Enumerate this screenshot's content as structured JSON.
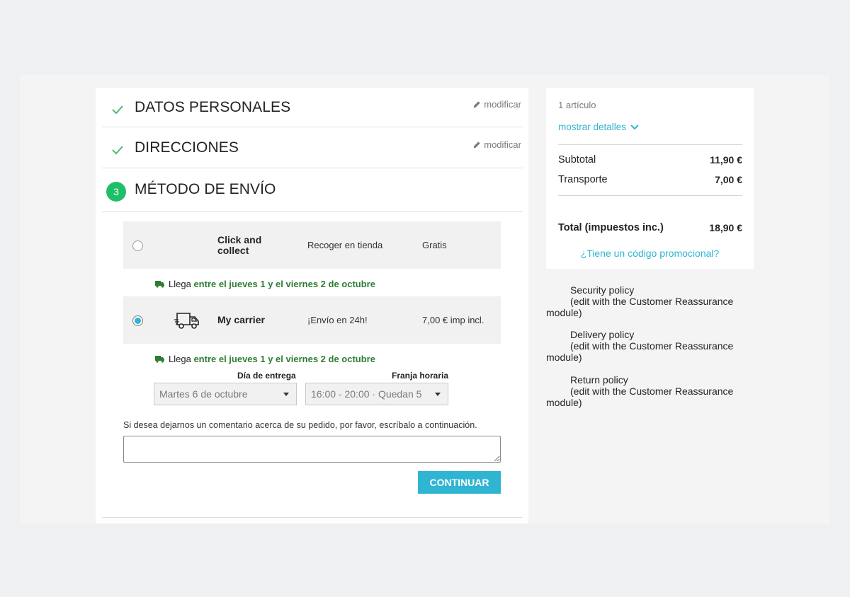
{
  "steps": [
    {
      "title": "DATOS PERSONALES",
      "edit_label": "modificar"
    },
    {
      "title": "DIRECCIONES",
      "edit_label": "modificar"
    },
    {
      "number": "3",
      "title": "MÉTODO DE ENVÍO"
    }
  ],
  "carriers": [
    {
      "name": "Click and collect",
      "delay": "Recoger en tienda",
      "price": "Gratis",
      "selected": false
    },
    {
      "name": "My carrier",
      "delay": "¡Envío en 24h!",
      "price": "7,00 € imp incl.",
      "selected": true,
      "icon": "truck-icon"
    }
  ],
  "eta": {
    "prefix": "Llega",
    "range": "entre el jueves 1 y el viernes 2 de octubre"
  },
  "delivery": {
    "day_label": "Día de entrega",
    "day_value": "Martes 6 de octubre",
    "slot_label": "Franja horaria",
    "slot_value": "16:00 - 20:00 · Quedan 5"
  },
  "comment": {
    "label": "Si desea dejarnos un comentario acerca de su pedido, por favor, escríbalo a continuación.",
    "value": ""
  },
  "continue_label": "CONTINUAR",
  "summary": {
    "item_count": "1 artículo",
    "show_details": "mostrar detalles",
    "subtotal_label": "Subtotal",
    "subtotal_value": "11,90 €",
    "shipping_label": "Transporte",
    "shipping_value": "7,00 €",
    "total_label": "Total (impuestos inc.)",
    "total_value": "18,90 €",
    "promo_link": "¿Tiene un código promocional?"
  },
  "reassurance": [
    {
      "title": "Security policy",
      "desc": "(edit with the Customer Reassurance module)"
    },
    {
      "title": "Delivery policy",
      "desc": "(edit with the Customer Reassurance module)"
    },
    {
      "title": "Return policy",
      "desc": "(edit with the Customer Reassurance module)"
    }
  ],
  "colors": {
    "accent": "#2fb5d2",
    "success": "#1fbf6a",
    "eta_green": "#2e7d32"
  }
}
